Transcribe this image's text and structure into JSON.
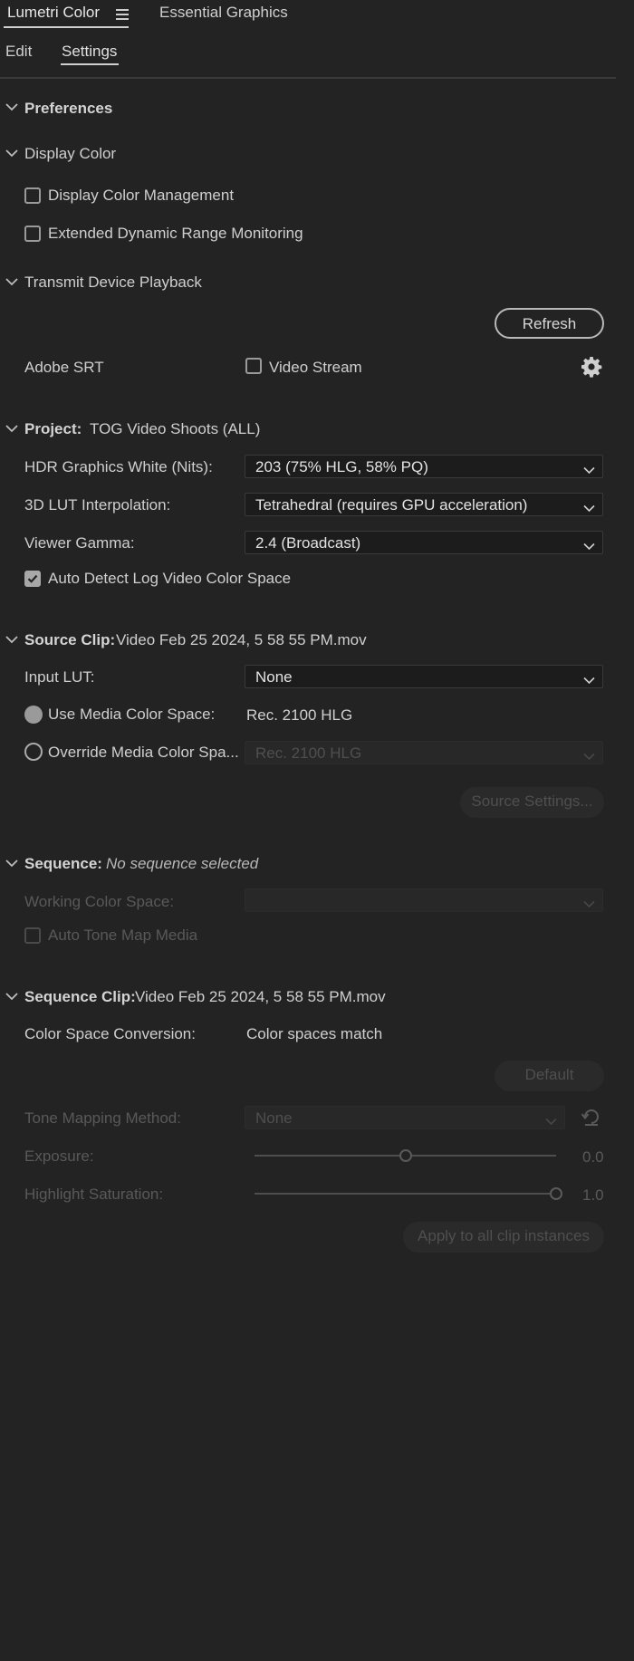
{
  "tabs": [
    {
      "label": "Lumetri Color",
      "active": true
    },
    {
      "label": "Essential Graphics",
      "active": false
    }
  ],
  "subtabs": [
    {
      "label": "Edit",
      "active": false
    },
    {
      "label": "Settings",
      "active": true
    }
  ],
  "icons": {
    "panel_menu": "hamburger-menu-icon",
    "section_toggle": "chevron-down-icon",
    "dropdown": "chevron-down-icon",
    "settings": "gear-icon",
    "reset": "reset-icon"
  },
  "preferences": {
    "title": "Preferences"
  },
  "display_color": {
    "title": "Display Color",
    "display_color_management": {
      "label": "Display Color Management",
      "checked": false
    },
    "extended_dynamic_range": {
      "label": "Extended Dynamic Range Monitoring",
      "checked": false
    }
  },
  "transmit": {
    "title": "Transmit Device Playback",
    "refresh_label": "Refresh",
    "adobe_srt_label": "Adobe SRT",
    "video_stream": {
      "label": "Video Stream",
      "checked": false
    }
  },
  "project": {
    "title": "Project:",
    "name": "TOG Video Shoots (ALL)",
    "hdr_white": {
      "label": "HDR Graphics White (Nits):",
      "value": "203 (75% HLG, 58% PQ)"
    },
    "lut_interp": {
      "label": "3D LUT Interpolation:",
      "value": "Tetrahedral (requires GPU acceleration)"
    },
    "viewer_gamma": {
      "label": "Viewer Gamma:",
      "value": "2.4 (Broadcast)"
    },
    "auto_detect": {
      "label": "Auto Detect Log Video Color Space",
      "checked": true
    }
  },
  "source_clip": {
    "title": "Source Clip:",
    "name": "Video Feb 25 2024, 5 58 55 PM.mov",
    "input_lut": {
      "label": "Input LUT:",
      "value": "None"
    },
    "use_media": {
      "label": "Use Media Color Space:",
      "value": "Rec. 2100 HLG",
      "selected": true
    },
    "override_media": {
      "label": "Override Media Color Spa...",
      "value": "Rec. 2100 HLG",
      "selected": false
    },
    "source_settings_label": "Source Settings..."
  },
  "sequence": {
    "title": "Sequence:",
    "name": "No sequence selected",
    "working_space_label": "Working Color Space:",
    "working_space_value": "",
    "auto_tone_map": {
      "label": "Auto Tone Map Media",
      "checked": false
    }
  },
  "sequence_clip": {
    "title": "Sequence Clip:",
    "name": "Video Feb 25 2024, 5 58 55 PM.mov",
    "conversion_label": "Color Space Conversion:",
    "conversion_value": "Color spaces match",
    "default_label": "Default",
    "tone_mapping": {
      "label": "Tone Mapping Method:",
      "value": "None"
    },
    "exposure": {
      "label": "Exposure:",
      "value_text": "0.0",
      "min": -2,
      "max": 2,
      "value": 0.0
    },
    "highlight_saturation": {
      "label": "Highlight Saturation:",
      "value_text": "1.0",
      "min": 0,
      "max": 1,
      "value": 1.0
    },
    "apply_label": "Apply to all clip instances"
  }
}
